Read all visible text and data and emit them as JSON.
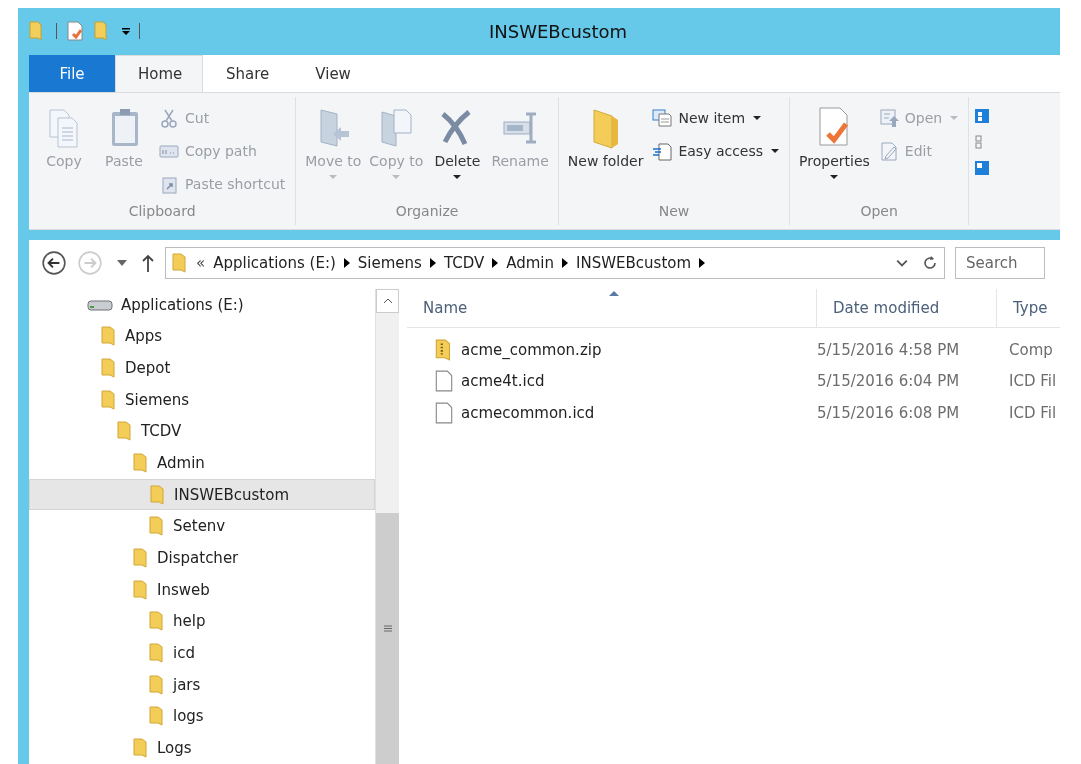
{
  "window": {
    "title": "INSWEBcustom"
  },
  "ribbon_tabs": [
    {
      "label": "File",
      "kind": "file",
      "selected": false
    },
    {
      "label": "Home",
      "kind": "tab",
      "selected": true
    },
    {
      "label": "Share",
      "kind": "tab",
      "selected": false
    },
    {
      "label": "View",
      "kind": "tab",
      "selected": false
    }
  ],
  "ribbon_groups": [
    {
      "label": "Clipboard",
      "items": [
        {
          "kind": "large",
          "label": "Copy",
          "disabled": true,
          "dropdown": false
        },
        {
          "kind": "large",
          "label": "Paste",
          "disabled": true,
          "dropdown": false
        },
        {
          "kind": "stack",
          "items": [
            {
              "label": "Cut",
              "disabled": true,
              "dropdown": false
            },
            {
              "label": "Copy path",
              "disabled": true,
              "dropdown": false
            },
            {
              "label": "Paste shortcut",
              "disabled": true,
              "dropdown": false
            }
          ]
        }
      ]
    },
    {
      "label": "Organize",
      "items": [
        {
          "kind": "large",
          "label": "Move to",
          "disabled": true,
          "dropdown": true
        },
        {
          "kind": "large",
          "label": "Copy to",
          "disabled": true,
          "dropdown": true
        },
        {
          "kind": "large",
          "label": "Delete",
          "disabled": false,
          "dropdown": true
        },
        {
          "kind": "large",
          "label": "Rename",
          "disabled": true,
          "dropdown": false
        }
      ]
    },
    {
      "label": "New",
      "items": [
        {
          "kind": "large",
          "label": "New folder",
          "disabled": false,
          "dropdown": false
        },
        {
          "kind": "stack",
          "items": [
            {
              "label": "New item",
              "disabled": false,
              "dropdown": true
            },
            {
              "label": "Easy access",
              "disabled": false,
              "dropdown": true
            }
          ]
        }
      ]
    },
    {
      "label": "Open",
      "items": [
        {
          "kind": "large",
          "label": "Properties",
          "disabled": false,
          "dropdown": true
        },
        {
          "kind": "stack",
          "items": [
            {
              "label": "Open",
              "disabled": true,
              "dropdown": true
            },
            {
              "label": "Edit",
              "disabled": true,
              "dropdown": false
            }
          ]
        }
      ]
    }
  ],
  "address_bar": {
    "overflow": "«",
    "segments": [
      "Applications (E:)",
      "Siemens",
      "TCDV",
      "Admin",
      "INSWEBcustom"
    ]
  },
  "search": {
    "placeholder": "Search"
  },
  "nav_tree": [
    {
      "label": "Applications (E:)",
      "kind": "drive",
      "selected": false,
      "children": [
        {
          "label": "Apps",
          "kind": "folder",
          "selected": false
        },
        {
          "label": "Depot",
          "kind": "folder",
          "selected": false
        },
        {
          "label": "Siemens",
          "kind": "folder",
          "selected": false,
          "children": [
            {
              "label": "TCDV",
              "kind": "folder",
              "selected": false,
              "children": [
                {
                  "label": "Admin",
                  "kind": "folder",
                  "selected": false,
                  "children": [
                    {
                      "label": "INSWEBcustom",
                      "kind": "folder",
                      "selected": true
                    },
                    {
                      "label": "Setenv",
                      "kind": "folder",
                      "selected": false
                    }
                  ]
                },
                {
                  "label": "Dispatcher",
                  "kind": "folder",
                  "selected": false
                },
                {
                  "label": "Insweb",
                  "kind": "folder",
                  "selected": false,
                  "children": [
                    {
                      "label": "help",
                      "kind": "folder",
                      "selected": false
                    },
                    {
                      "label": "icd",
                      "kind": "folder",
                      "selected": false
                    },
                    {
                      "label": "jars",
                      "kind": "folder",
                      "selected": false
                    },
                    {
                      "label": "logs",
                      "kind": "folder",
                      "selected": false
                    }
                  ]
                },
                {
                  "label": "Logs",
                  "kind": "folder",
                  "selected": false
                }
              ]
            }
          ]
        }
      ]
    }
  ],
  "file_list": {
    "columns": [
      "Name",
      "Date modified",
      "Type"
    ],
    "rows": [
      {
        "kind": "zip",
        "name": "acme_common.zip",
        "date": "5/15/2016 4:58 PM",
        "type": "Comp"
      },
      {
        "kind": "file",
        "name": "acme4t.icd",
        "date": "5/15/2016 6:04 PM",
        "type": "ICD Fil"
      },
      {
        "kind": "file",
        "name": "acmecommon.icd",
        "date": "5/15/2016 6:08 PM",
        "type": "ICD Fil"
      }
    ]
  }
}
